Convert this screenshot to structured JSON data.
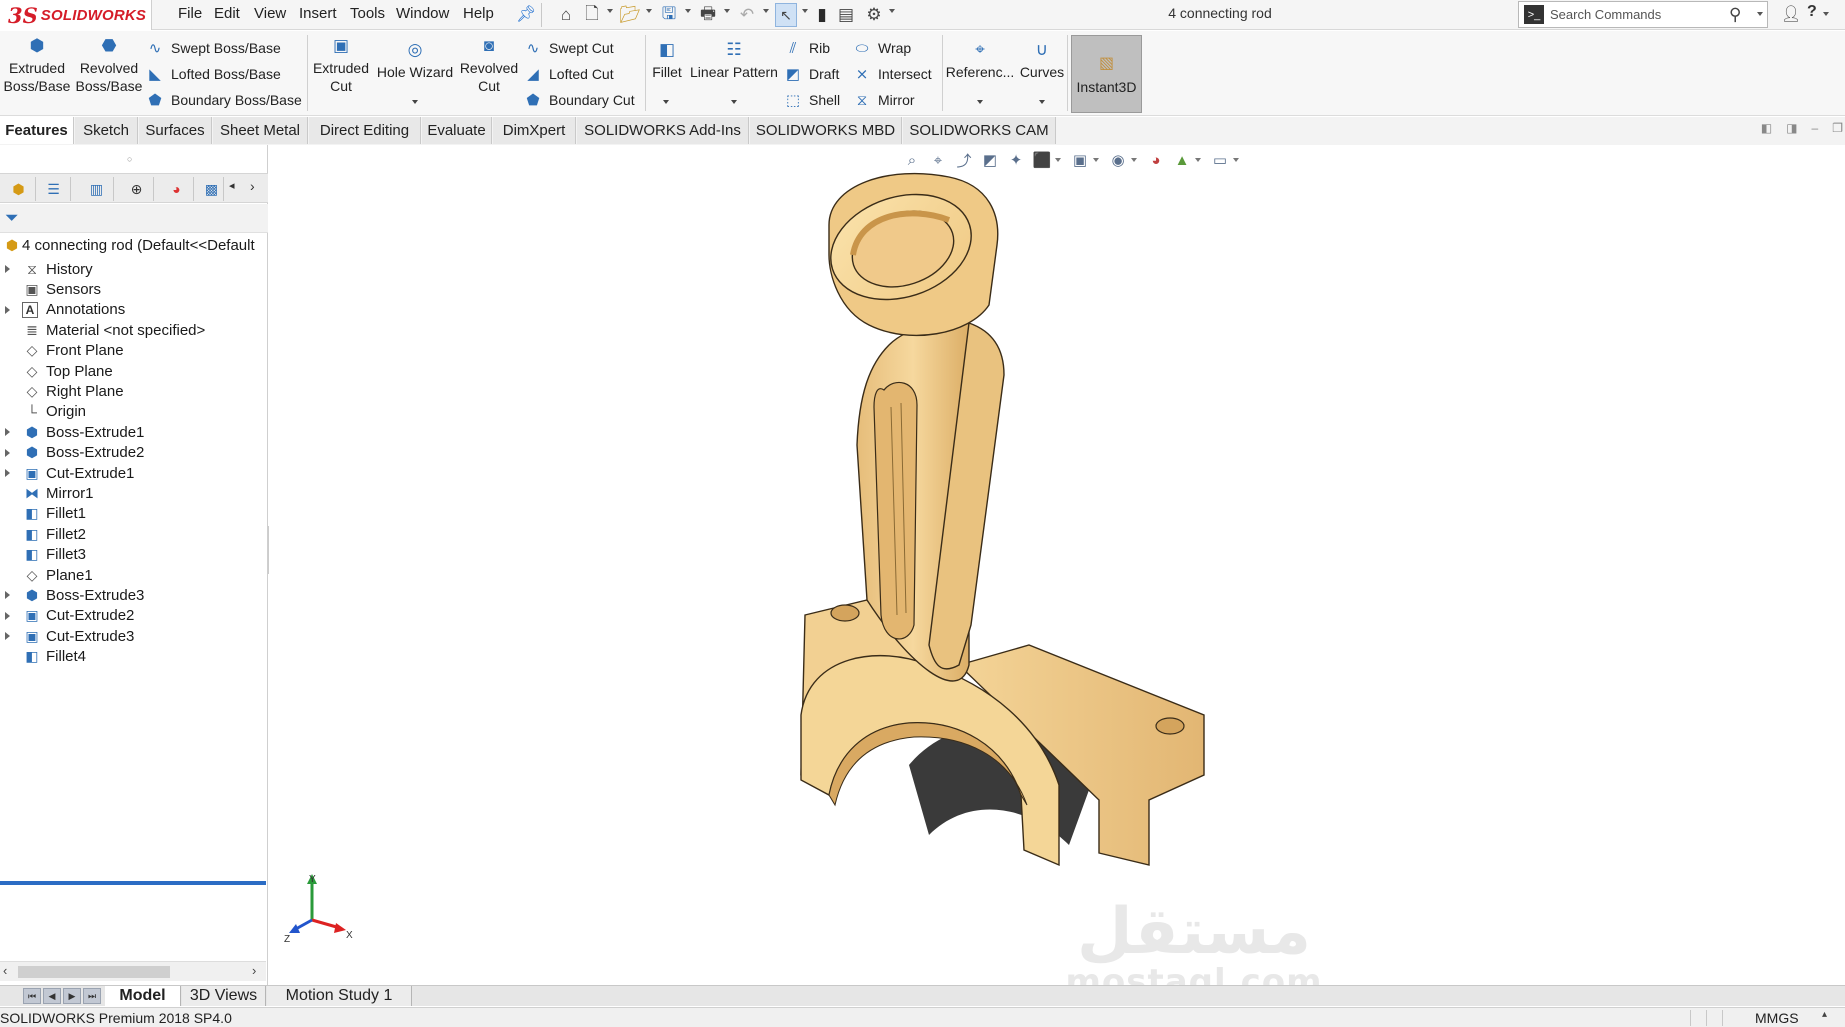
{
  "app": {
    "brand_mark": "3S",
    "brand_name": "SOLIDWORKS",
    "document_title": "4 connecting rod"
  },
  "menu": [
    "File",
    "Edit",
    "View",
    "Insert",
    "Tools",
    "Window",
    "Help"
  ],
  "search": {
    "placeholder": "Search Commands"
  },
  "command_manager": {
    "extruded_boss": [
      "Extruded",
      "Boss/Base"
    ],
    "revolved_boss": [
      "Revolved",
      "Boss/Base"
    ],
    "swept_boss": "Swept Boss/Base",
    "lofted_boss": "Lofted Boss/Base",
    "boundary_boss": "Boundary Boss/Base",
    "extruded_cut": [
      "Extruded",
      "Cut"
    ],
    "hole_wizard": "Hole Wizard",
    "revolved_cut": [
      "Revolved",
      "Cut"
    ],
    "swept_cut": "Swept Cut",
    "lofted_cut": "Lofted Cut",
    "boundary_cut": "Boundary Cut",
    "fillet": "Fillet",
    "linear_pattern": "Linear Pattern",
    "rib": "Rib",
    "draft": "Draft",
    "shell": "Shell",
    "wrap": "Wrap",
    "intersect": "Intersect",
    "mirror": "Mirror",
    "reference": "Referenc...",
    "curves": "Curves",
    "instant3d": "Instant3D"
  },
  "tabs": [
    "Features",
    "Sketch",
    "Surfaces",
    "Sheet Metal",
    "Direct Editing",
    "Evaluate",
    "DimXpert",
    "SOLIDWORKS Add-Ins",
    "SOLIDWORKS MBD",
    "SOLIDWORKS CAM"
  ],
  "tree": {
    "root": "4 connecting rod  (Default<<Default",
    "items": [
      {
        "label": "History",
        "icon": "history-icon",
        "expand": true
      },
      {
        "label": "Sensors",
        "icon": "sensors-icon",
        "expand": false
      },
      {
        "label": "Annotations",
        "icon": "annotations-icon",
        "expand": true
      },
      {
        "label": "Material <not specified>",
        "icon": "material-icon",
        "expand": false
      },
      {
        "label": "Front Plane",
        "icon": "plane-icon",
        "expand": false
      },
      {
        "label": "Top Plane",
        "icon": "plane-icon",
        "expand": false
      },
      {
        "label": "Right Plane",
        "icon": "plane-icon",
        "expand": false
      },
      {
        "label": "Origin",
        "icon": "origin-icon",
        "expand": false
      },
      {
        "label": "Boss-Extrude1",
        "icon": "boss-extrude-icon",
        "expand": true
      },
      {
        "label": "Boss-Extrude2",
        "icon": "boss-extrude-icon",
        "expand": true
      },
      {
        "label": "Cut-Extrude1",
        "icon": "cut-extrude-icon",
        "expand": true
      },
      {
        "label": "Mirror1",
        "icon": "mirror-feature-icon",
        "expand": false
      },
      {
        "label": "Fillet1",
        "icon": "fillet-feature-icon",
        "expand": false
      },
      {
        "label": "Fillet2",
        "icon": "fillet-feature-icon",
        "expand": false
      },
      {
        "label": "Fillet3",
        "icon": "fillet-feature-icon",
        "expand": false
      },
      {
        "label": "Plane1",
        "icon": "plane-icon",
        "expand": false
      },
      {
        "label": "Boss-Extrude3",
        "icon": "boss-extrude-icon",
        "expand": true
      },
      {
        "label": "Cut-Extrude2",
        "icon": "cut-extrude-icon",
        "expand": true
      },
      {
        "label": "Cut-Extrude3",
        "icon": "cut-extrude-icon",
        "expand": true
      },
      {
        "label": "Fillet4",
        "icon": "fillet-feature-icon",
        "expand": false
      }
    ]
  },
  "triad": {
    "x": "X",
    "y": "Y",
    "z": "Z"
  },
  "watermark": {
    "arabic": "مستقل",
    "latin": "mostaql.com"
  },
  "bottom_tabs": [
    "Model",
    "3D Views",
    "Motion Study 1"
  ],
  "status": {
    "left": "SOLIDWORKS Premium 2018 SP4.0",
    "units": "MMGS"
  },
  "colors": {
    "brand_red": "#d51c28",
    "accent_blue": "#2b6cc4",
    "part_face": "#f3d49a",
    "part_shade": "#d9a962"
  }
}
